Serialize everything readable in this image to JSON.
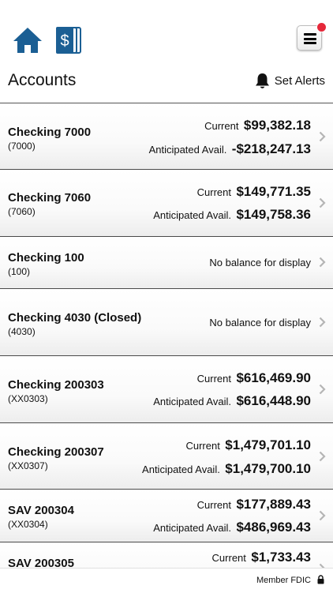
{
  "header": {
    "title": "Accounts",
    "set_alerts_label": "Set Alerts"
  },
  "icons": {
    "home": "home-icon",
    "statements": "statements-icon",
    "menu": "hamburger-menu-icon",
    "bell": "bell-icon",
    "chevron": "chevron-right-icon",
    "lock": "lock-icon"
  },
  "colors": {
    "brand_blue": "#1b5f94",
    "notification_red": "#e5283a",
    "chevron_gray": "#b5b5b5",
    "divider": "#4a4a4a"
  },
  "accounts": [
    {
      "name": "Checking 7000",
      "number": "(7000)",
      "current_label": "Current",
      "current": "$99,382.18",
      "anticipated_label": "Anticipated Avail.",
      "anticipated": "-$218,247.13"
    },
    {
      "name": "Checking 7060",
      "number": "(7060)",
      "current_label": "Current",
      "current": "$149,771.35",
      "anticipated_label": "Anticipated Avail.",
      "anticipated": "$149,758.36"
    },
    {
      "name": "Checking 100",
      "number": "(100)",
      "no_balance": "No balance for display"
    },
    {
      "name": "Checking 4030 (Closed)",
      "number": "(4030)",
      "no_balance": "No balance for display"
    },
    {
      "name": "Checking 200303",
      "number": "(XX0303)",
      "current_label": "Current",
      "current": "$616,469.90",
      "anticipated_label": "Anticipated Avail.",
      "anticipated": "$616,448.90"
    },
    {
      "name": "Checking 200307",
      "number": "(XX0307)",
      "current_label": "Current",
      "current": "$1,479,701.10",
      "anticipated_label": "Anticipated Avail.",
      "anticipated": "$1,479,700.10"
    },
    {
      "name": "SAV 200304",
      "number": "(XX0304)",
      "current_label": "Current",
      "current": "$177,889.43",
      "anticipated_label": "Anticipated Avail.",
      "anticipated": "$486,969.43"
    },
    {
      "name": "SAV 200305",
      "number": "",
      "current_label": "Current",
      "current": "$1,733.43",
      "anticipated_label": "",
      "anticipated": ""
    }
  ],
  "footer": {
    "member_fdic": "Member FDIC"
  }
}
